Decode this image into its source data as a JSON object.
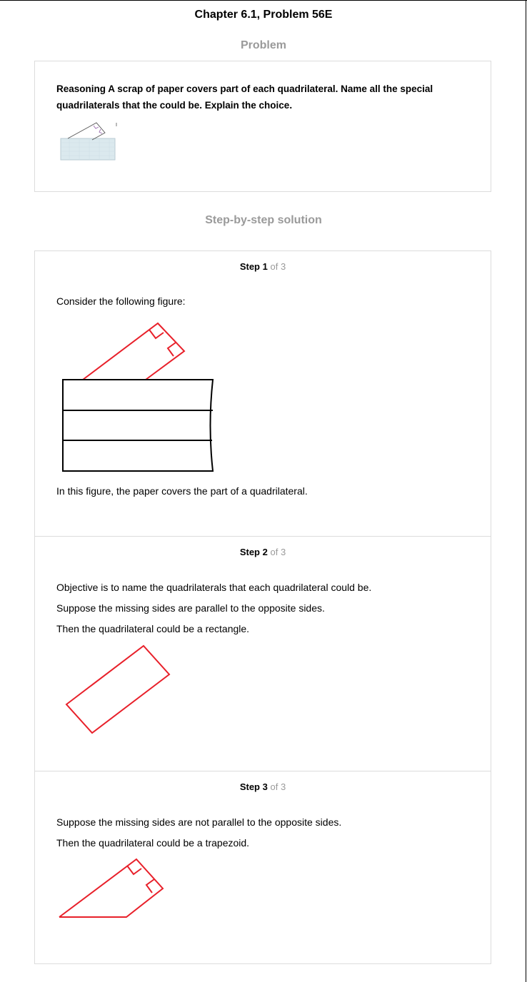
{
  "header": {
    "title": "Chapter 6.1, Problem 56E"
  },
  "problem": {
    "section_label": "Problem",
    "text": "Reasoning A scrap of paper covers part of each quadrilateral. Name all the special quadrilaterals that the could be. Explain the choice."
  },
  "solution": {
    "section_label": "Step-by-step solution",
    "steps": [
      {
        "label": "Step",
        "number": "1",
        "of_text": "of 3",
        "paragraphs": [
          "Consider the following figure:",
          "In this figure, the paper covers the part of a quadrilateral."
        ]
      },
      {
        "label": "Step",
        "number": "2",
        "of_text": "of 3",
        "paragraphs": [
          "Objective is to name the quadrilaterals that each quadrilateral could be.",
          "Suppose the missing sides are parallel to the opposite sides.",
          "Then the quadrilateral could be a rectangle."
        ]
      },
      {
        "label": "Step",
        "number": "3",
        "of_text": "of 3",
        "paragraphs": [
          "Suppose the missing sides are not parallel to the opposite sides.",
          "Then the quadrilateral could be a trapezoid."
        ]
      }
    ]
  },
  "colors": {
    "figure_stroke": "#e8202a",
    "muted_text": "#9a9a9a",
    "border": "#dcdcdc"
  }
}
